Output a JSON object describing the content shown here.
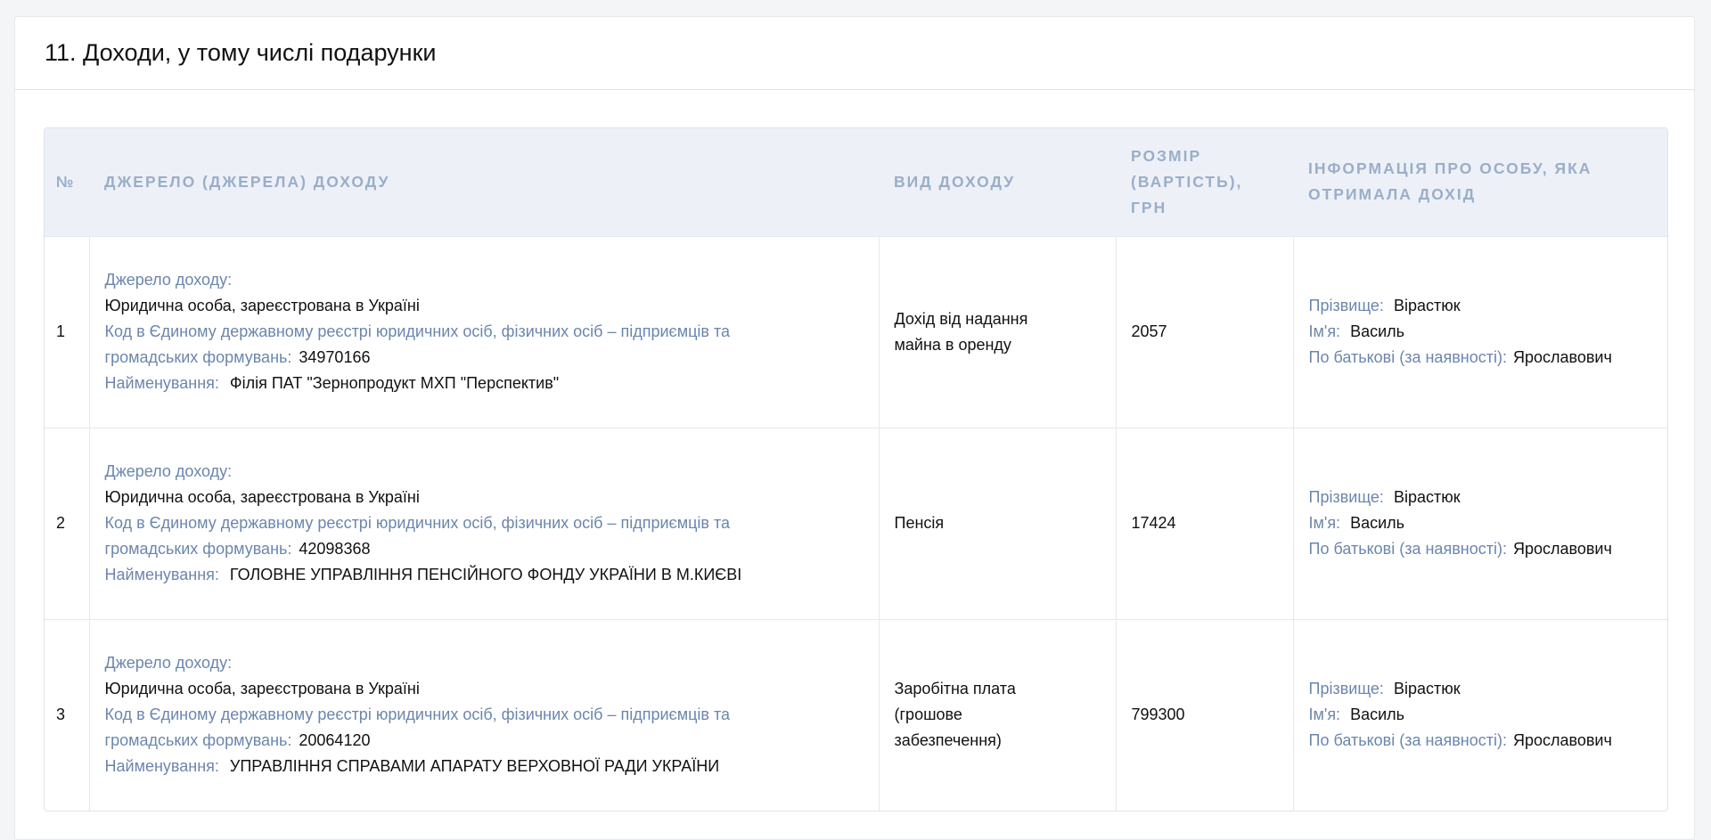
{
  "section": {
    "title": "11. Доходи, у тому числі подарунки"
  },
  "table": {
    "headers": {
      "num": "№",
      "source": "Джерело (джерела) доходу",
      "type": "Вид доходу",
      "amount": "Розмір (вартість), грн",
      "person": "Інформація про особу, яка отримала дохід"
    },
    "labels": {
      "source": "Джерело доходу:",
      "code": "Код в Єдиному державному реєстрі юридичних осіб, фізичних осіб – підприємців та громадських формувань:",
      "name": "Найменування:",
      "surname": "Прізвище:",
      "firstname": "Ім'я:",
      "patronymic": "По батькові (за наявності):"
    },
    "rows": [
      {
        "num": "1",
        "source_type": "Юридична особа, зареєстрована в Україні",
        "code": "34970166",
        "name": "Філія ПАТ \"Зернопродукт МХП \"Перспектив\"",
        "income_type": "Дохід від надання майна в оренду",
        "amount": "2057",
        "surname": "Вірастюк",
        "firstname": "Василь",
        "patronymic": "Ярославович"
      },
      {
        "num": "2",
        "source_type": "Юридична особа, зареєстрована в Україні",
        "code": "42098368",
        "name": "ГОЛОВНЕ УПРАВЛІННЯ ПЕНСІЙНОГО ФОНДУ УКРАЇНИ В М.КИЄВІ",
        "income_type": "Пенсія",
        "amount": "17424",
        "surname": "Вірастюк",
        "firstname": "Василь",
        "patronymic": "Ярославович"
      },
      {
        "num": "3",
        "source_type": "Юридична особа, зареєстрована в Україні",
        "code": "20064120",
        "name": "УПРАВЛІННЯ СПРАВАМИ АПАРАТУ ВЕРХОВНОЇ РАДИ УКРАЇНИ",
        "income_type": "Заробітна плата (грошове забезпечення)",
        "amount": "799300",
        "surname": "Вірастюк",
        "firstname": "Василь",
        "patronymic": "Ярославович"
      }
    ]
  }
}
